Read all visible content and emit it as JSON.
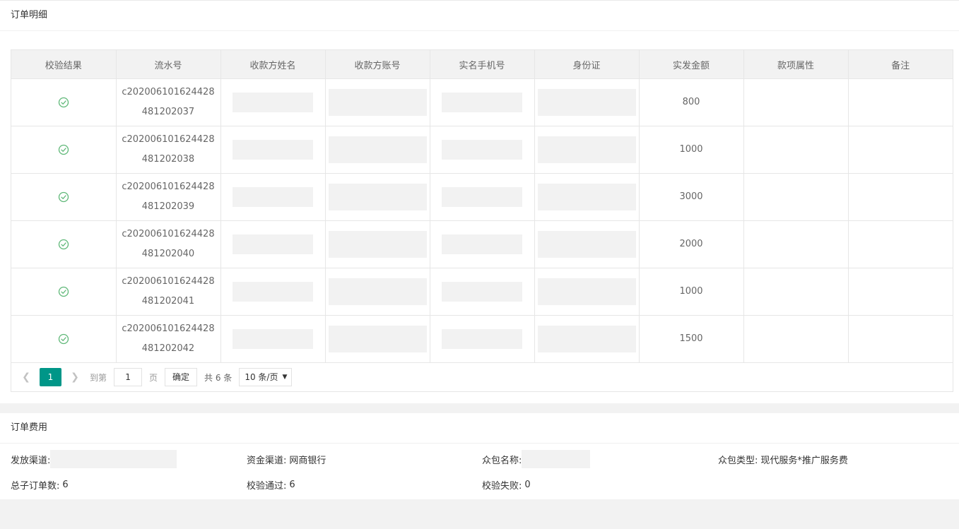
{
  "order_detail": {
    "title": "订单明细",
    "columns": [
      "校验结果",
      "流水号",
      "收款方姓名",
      "收款方账号",
      "实名手机号",
      "身份证",
      "实发金额",
      "款项属性",
      "备注"
    ],
    "rows": [
      {
        "serial": "c202006101624428481202037",
        "amount": "800"
      },
      {
        "serial": "c202006101624428481202038",
        "amount": "1000"
      },
      {
        "serial": "c202006101624428481202039",
        "amount": "3000"
      },
      {
        "serial": "c202006101624428481202040",
        "amount": "2000"
      },
      {
        "serial": "c202006101624428481202041",
        "amount": "1000"
      },
      {
        "serial": "c202006101624428481202042",
        "amount": "1500"
      }
    ],
    "status_icon": "check-circle-icon",
    "pagination": {
      "current_page": "1",
      "goto_label": "到第",
      "page_input": "1",
      "page_unit": "页",
      "confirm_label": "确定",
      "total_text": "共 6 条",
      "page_size": "10 条/页"
    }
  },
  "order_fee": {
    "title": "订单费用",
    "payout_channel_label": "发放渠道:",
    "fund_channel_label": "资金渠道:",
    "fund_channel_value": "网商银行",
    "crowd_name_label": "众包名称:",
    "crowd_type_label": "众包类型:",
    "crowd_type_value": "现代服务*推广服务费",
    "total_suborders_label": "总子订单数:",
    "total_suborders_value": "6",
    "verify_pass_label": "校验通过:",
    "verify_pass_value": "6",
    "verify_fail_label": "校验失败:",
    "verify_fail_value": "0"
  },
  "colors": {
    "accent": "#009688",
    "success": "#5fb878"
  }
}
